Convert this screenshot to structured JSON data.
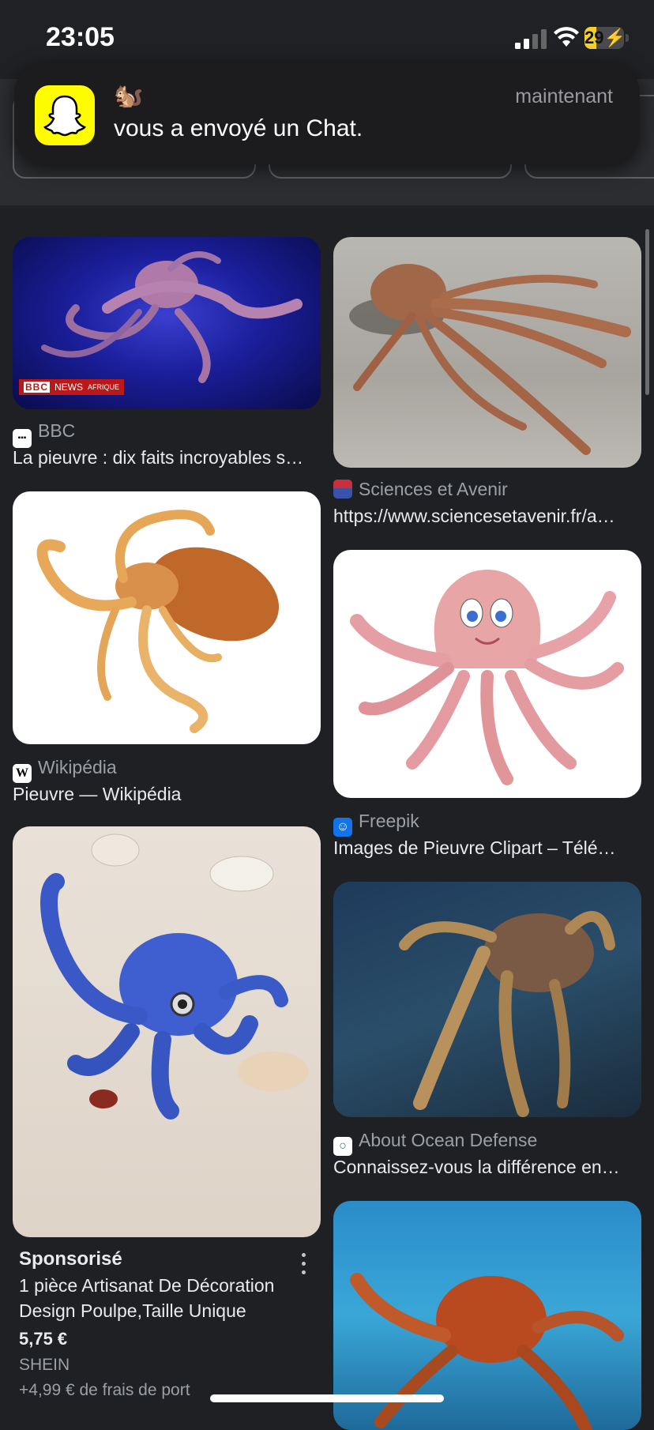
{
  "status_bar": {
    "time": "23:05",
    "battery_level": "29",
    "battery_fill_fraction": 0.29,
    "icons": [
      "cellular-signal-icon",
      "wifi-icon",
      "battery-charging-icon"
    ]
  },
  "notification": {
    "app_icon": "snapchat-ghost-icon",
    "sender_emoji": "🐿️",
    "message": "vous a envoyé un Chat.",
    "time": "maintenant"
  },
  "results": [
    {
      "source": "BBC",
      "favicon": "bbc-favicon",
      "caption": "La pieuvre : dix faits incroyables s…",
      "overlay": {
        "brand": "BBC",
        "label": "NEWS",
        "region": "AFRIQUE"
      }
    },
    {
      "source": "Sciences et Avenir",
      "favicon": "sciences-et-avenir-favicon",
      "caption": "https://www.sciencesetavenir.fr/a…"
    },
    {
      "source": "Wikipédia",
      "favicon": "wikipedia-favicon",
      "caption": "Pieuvre — Wikipédia",
      "favicon_letter": "W"
    },
    {
      "source": "Freepik",
      "favicon": "freepik-favicon",
      "caption": "Images de Pieuvre Clipart – Téléc…"
    },
    {
      "source": "About Ocean Defense",
      "favicon": "about-ocean-defense-favicon",
      "caption": "Connaissez-vous la différence ent…"
    }
  ],
  "sponsored": {
    "label": "Sponsorisé",
    "title_line1": "1 pièce Artisanat De Décoration",
    "title_line2": "Design Poulpe,Taille Unique",
    "price": "5,75 €",
    "merchant": "SHEIN",
    "shipping": "+4,99 € de frais de port"
  },
  "colors": {
    "background": "#1f2023",
    "snapchat_yellow": "#fffc00",
    "battery_yellow": "#f5d02a",
    "bbc_red": "#bb1919"
  }
}
